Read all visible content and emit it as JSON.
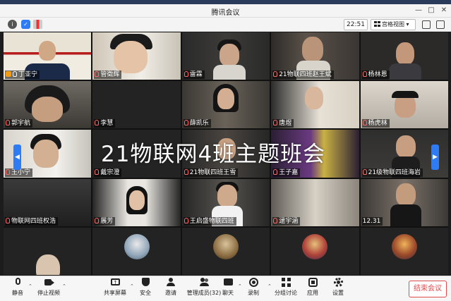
{
  "window": {
    "title": "腾讯会议"
  },
  "top_bar": {
    "timer": "22:51",
    "view_mode": "宫格视图"
  },
  "overlay": {
    "meeting_title": "21物联网4班主题班会"
  },
  "participants": [
    {
      "name": "丁亚宁",
      "host": true
    },
    {
      "name": "管徵辉"
    },
    {
      "name": "雷霖"
    },
    {
      "name": "21物联四班赵王斌"
    },
    {
      "name": "杨林恩"
    },
    {
      "name": "郭宇航"
    },
    {
      "name": "李慧"
    },
    {
      "name": "薛凯乐"
    },
    {
      "name": "唐煜"
    },
    {
      "name": "杨虎林"
    },
    {
      "name": "王小宁"
    },
    {
      "name": "戴宗澄"
    },
    {
      "name": "21物联四班王雪"
    },
    {
      "name": "王子嘉"
    },
    {
      "name": "21级物联四班海岩"
    },
    {
      "name": "物联网四班权浩"
    },
    {
      "name": "展芳"
    },
    {
      "name": "王启盛物联四班"
    },
    {
      "name": "逯宇涵"
    },
    {
      "name": "12.31"
    }
  ],
  "bottom_toolbar": {
    "mute": "静音",
    "stop_video": "停止视频",
    "share_screen": "共享屏幕",
    "security": "安全",
    "invite": "邀请",
    "manage_members": "管理成员(32)",
    "chat": "聊天",
    "record": "录制",
    "breakout": "分组讨论",
    "apps": "应用",
    "settings": "设置",
    "end_meeting": "结束会议"
  }
}
